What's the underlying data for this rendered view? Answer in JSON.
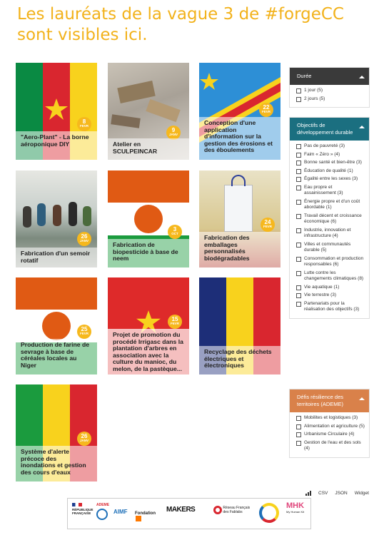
{
  "page": {
    "title": "Les lauréats de la vague 3 de #forgeCC sont visibles ici."
  },
  "cards": [
    {
      "title": "\"Aero-Plant\" - La borne aéroponique DIY",
      "day": "8",
      "month": "FEVR"
    },
    {
      "title": "Atelier en SCULPEINCAR",
      "day": "9",
      "month": "JANV"
    },
    {
      "title": "Conception d'une application d'information sur la gestion des érosions et des éboulements",
      "day": "22",
      "month": "FEVR"
    },
    {
      "title": "Fabrication d'un semoir rotatif",
      "day": "26",
      "month": "JANV"
    },
    {
      "title": "Fabrication de biopesticide à base de neem",
      "day": "3",
      "month": "OCT"
    },
    {
      "title": "Fabrication des emballages personnalisés biodégradables",
      "day": "24",
      "month": "FEVR"
    },
    {
      "title": "Production de farine de sevrage à base de céréales locales au Niger",
      "day": "25",
      "month": "FEVR"
    },
    {
      "title": "Projet de promotion du procédé Irrigasc dans la plantation d'arbres en association avec la culture du manioc, du melon, de la pastèque...",
      "day": "15",
      "month": "FEVR"
    },
    {
      "title": "Recyclage des déchets électriques et électroniques",
      "day": "",
      "month": ""
    },
    {
      "title": "Système d'alerte précoce des inondations et gestion des cours d'eaux",
      "day": "26",
      "month": "JANV"
    }
  ],
  "filters": {
    "duree": {
      "title": "Durée",
      "color": "#3a3a3a",
      "options": [
        "1 jour (5)",
        "2 jours (5)"
      ]
    },
    "odd": {
      "title": "Objectifs de développement durable",
      "color": "#1b6f80",
      "options": [
        "Pas de pauvreté (3)",
        "Faim « Zéro » (4)",
        "Bonne santé et bien-être (3)",
        "Éducation de qualité (1)",
        "Égalité entre les sexes (3)",
        "Eau propre et assainissement (3)",
        "Énergie propre et d'un coût abordable (1)",
        "Travail décent et croissance économique (6)",
        "Industrie, innovation et infrastructure (4)",
        "Villes et communautés durable (5)",
        "Consommation et production responsables (6)",
        "Lutte contre les changements climatiques (8)",
        "Vie aquatique (1)",
        "Vie terrestre (3)",
        "Partenariats pour la réalisation des objectifs (3)"
      ]
    },
    "ademe": {
      "title": "Défis résilience des territoires (ADEME)",
      "color": "#d9814a",
      "options": [
        "Mobilites et logistiques (3)",
        "Alimentation et agriculture (5)",
        "Urbanisme Circulaire (4)",
        "Gestion de l'eau et des sols (4)"
      ]
    }
  },
  "exports": {
    "csv": "CSV",
    "json": "JSON",
    "widget": "Widget"
  },
  "logos": {
    "republique": "RÉPUBLIQUE FRANÇAISE",
    "ademe": "ADEME",
    "aimf": "AIMF",
    "fondation": "Fondation",
    "makers": "MAKERS",
    "reseau": "Réseau Français des Fablabs",
    "mhk": "MHK",
    "mhk_sub": "My Human Kit"
  },
  "colors": {
    "accent": "#f2b21b",
    "badge": "#f6b81d"
  }
}
